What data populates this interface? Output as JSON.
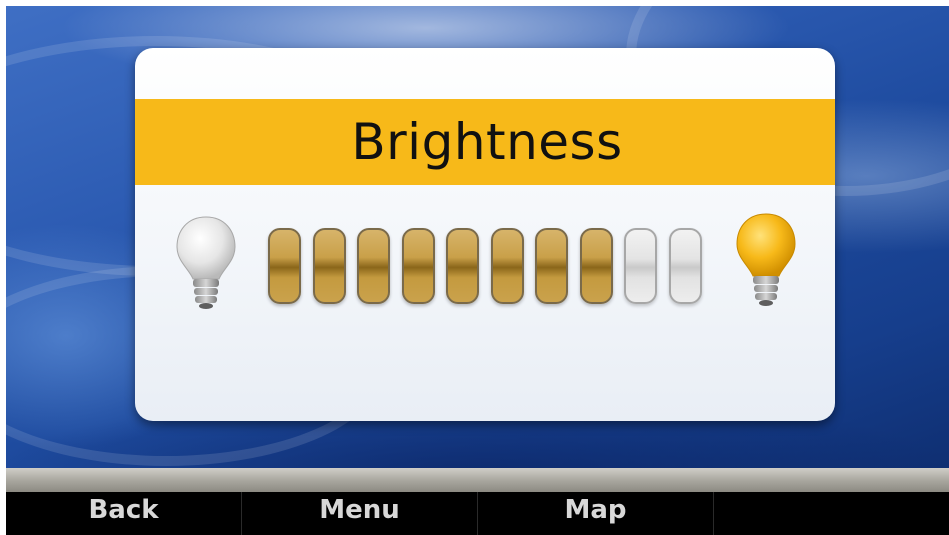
{
  "dialog": {
    "title": "Brightness"
  },
  "brightness": {
    "level": 8,
    "max": 10
  },
  "softkeys": [
    "Back",
    "Menu",
    "Map",
    ""
  ],
  "icons": {
    "left": "dim-bulb-icon",
    "right": "bright-bulb-icon"
  },
  "colors": {
    "title_band": "#f7b919",
    "segment_on": "#c9a049",
    "segment_off": "#e4e4e4",
    "background": "#2d5cb3"
  }
}
